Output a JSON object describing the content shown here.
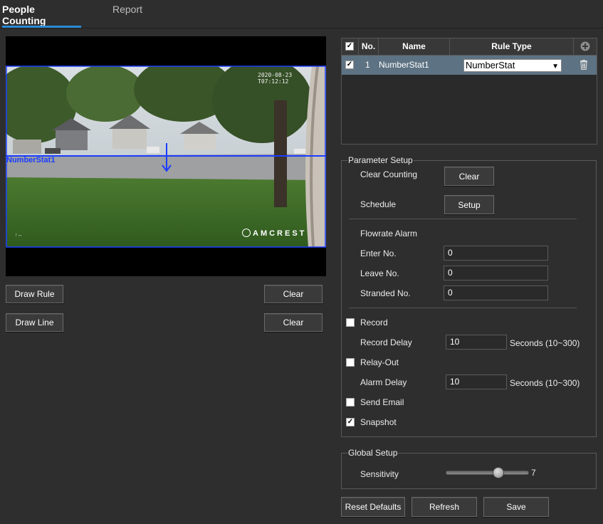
{
  "tabs": [
    {
      "label": "People Counting",
      "active": true
    },
    {
      "label": "Report",
      "active": false
    }
  ],
  "video": {
    "rule_label": "NumberStat1",
    "timestamp": "2020-08-23 T07:12:12",
    "watermark": "AMCREST",
    "corner_text": "↑↔"
  },
  "left_buttons": {
    "draw_rule": "Draw Rule",
    "clear_rule": "Clear",
    "draw_line": "Draw Line",
    "clear_line": "Clear"
  },
  "rules_table": {
    "headers": {
      "no": "No.",
      "name": "Name",
      "rule_type": "Rule Type"
    },
    "rows": [
      {
        "checked": true,
        "no": "1",
        "name": "NumberStat1",
        "rule_type": "NumberStat"
      }
    ]
  },
  "parameter_setup": {
    "legend": "Parameter Setup",
    "clear_counting_label": "Clear Counting",
    "clear_button": "Clear",
    "schedule_label": "Schedule",
    "setup_button": "Setup",
    "flowrate_alarm_label": "Flowrate Alarm",
    "enter_label": "Enter No.",
    "enter_value": "0",
    "leave_label": "Leave No.",
    "leave_value": "0",
    "stranded_label": "Stranded No.",
    "stranded_value": "0",
    "record_label": "Record",
    "record_checked": false,
    "record_delay_label": "Record Delay",
    "record_delay_value": "10",
    "record_delay_unit": "Seconds (10~300)",
    "relay_out_label": "Relay-Out",
    "relay_out_checked": false,
    "alarm_delay_label": "Alarm Delay",
    "alarm_delay_value": "10",
    "alarm_delay_unit": "Seconds (10~300)",
    "send_email_label": "Send Email",
    "send_email_checked": false,
    "snapshot_label": "Snapshot",
    "snapshot_checked": true
  },
  "global_setup": {
    "legend": "Global Setup",
    "sensitivity_label": "Sensitivity",
    "sensitivity_value": "7"
  },
  "footer": {
    "reset_defaults": "Reset Defaults",
    "refresh": "Refresh",
    "save": "Save"
  },
  "colors": {
    "accent": "#2b8cd6",
    "rule_blue": "#1b3dff",
    "row_selected": "#5d7282"
  }
}
